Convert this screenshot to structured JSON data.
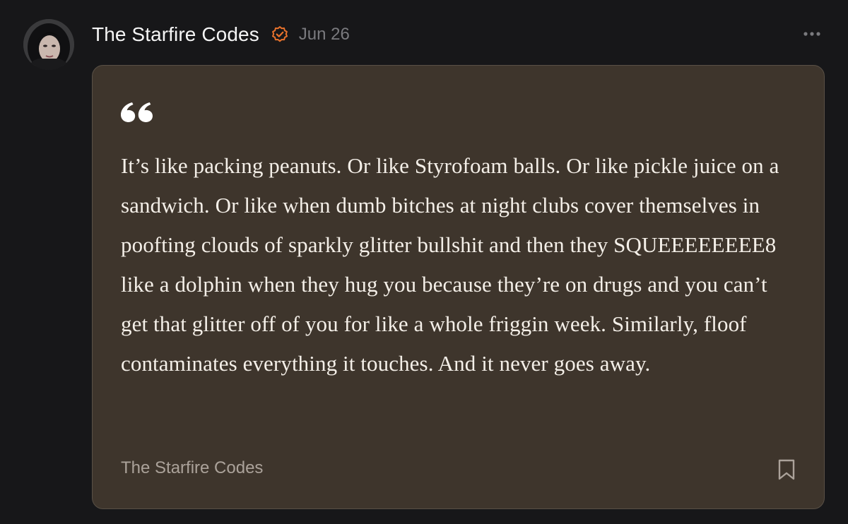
{
  "post": {
    "author_name": "The Starfire Codes",
    "date": "Jun 26",
    "verified": true,
    "icons": {
      "avatar": "avatar-photo",
      "verified": "verified-check-icon",
      "more": "more-options-icon",
      "quote": "quote-mark-icon",
      "bookmark": "bookmark-icon"
    }
  },
  "quote": {
    "text": "It’s like packing peanuts. Or like Styrofoam balls. Or like pickle juice on a sandwich. Or like when dumb bitches at night clubs cover themselves in poofting clouds of sparkly glitter bullshit and then they SQUEEEEEEEE8 like a dolphin when they hug you because they’re on drugs and you can’t get that glitter off of you for like a whole friggin week. Similarly, floof contaminates everything it touches. And it never goes away.",
    "source": "The Starfire Codes"
  },
  "colors": {
    "background": "#171719",
    "card_background": "#3e352c",
    "card_border": "#595046",
    "accent_verified": "#e8722c",
    "muted_text": "#7a7a7e",
    "source_text": "#aba29a"
  }
}
